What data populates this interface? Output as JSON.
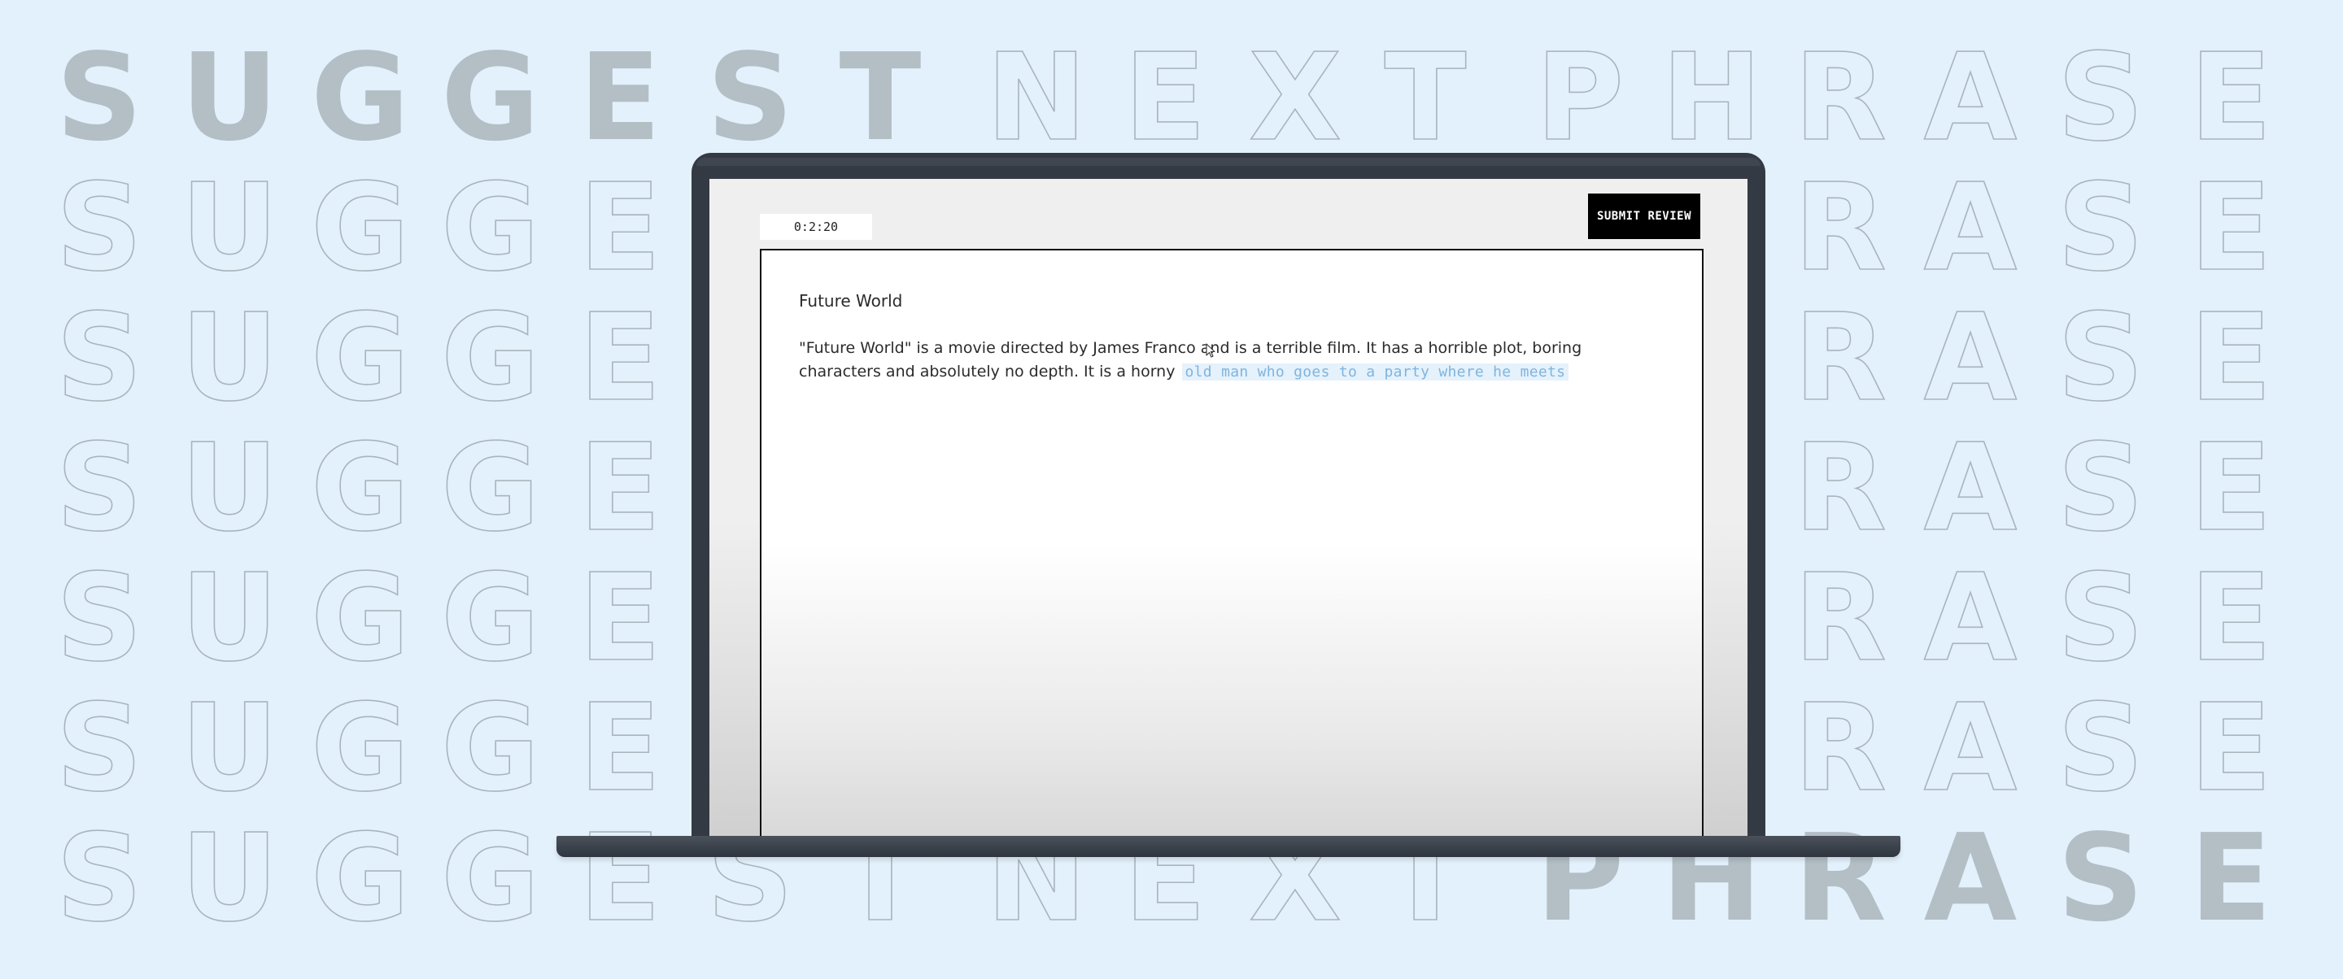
{
  "background": {
    "rows": [
      {
        "segments": [
          {
            "text": "SUGGEST",
            "style": "filled"
          },
          {
            "text": " NEXT PHRASE",
            "style": "outline"
          }
        ]
      },
      {
        "segments": [
          {
            "text": "SUGGEST NEXT PHRASE",
            "style": "outline"
          }
        ]
      },
      {
        "segments": [
          {
            "text": "SUGGEST NEXT PHRASE",
            "style": "outline"
          }
        ]
      },
      {
        "segments": [
          {
            "text": "SUGGEST NEXT PHRASE",
            "style": "outline"
          }
        ]
      },
      {
        "segments": [
          {
            "text": "SUGGEST NEXT PHRASE",
            "style": "outline"
          }
        ]
      },
      {
        "segments": [
          {
            "text": "SUGGEST NEXT PHRASE",
            "style": "outline"
          }
        ]
      },
      {
        "segments": [
          {
            "text": "SUGGEST NEXT ",
            "style": "outline"
          },
          {
            "text": "PHRASE",
            "style": "filled"
          }
        ]
      }
    ]
  },
  "app": {
    "timer": "0:2:20",
    "submit_label": "SUBMIT REVIEW",
    "document": {
      "title": "Future World",
      "body": "\"Future World\" is a movie directed by James Franco and is a terrible film. It has a horrible plot, boring characters and absolutely no depth. It is a horny",
      "suggestion": "old man who goes to a party where he meets"
    }
  },
  "colors": {
    "page_background": "#e3f1fd",
    "laptop_frame": "#343a44",
    "suggestion_text": "#7eb5df",
    "suggestion_highlight": "#e5f1fb",
    "submit_button": "#000000"
  },
  "icons": {
    "cursor": "mouse-pointer-icon"
  }
}
